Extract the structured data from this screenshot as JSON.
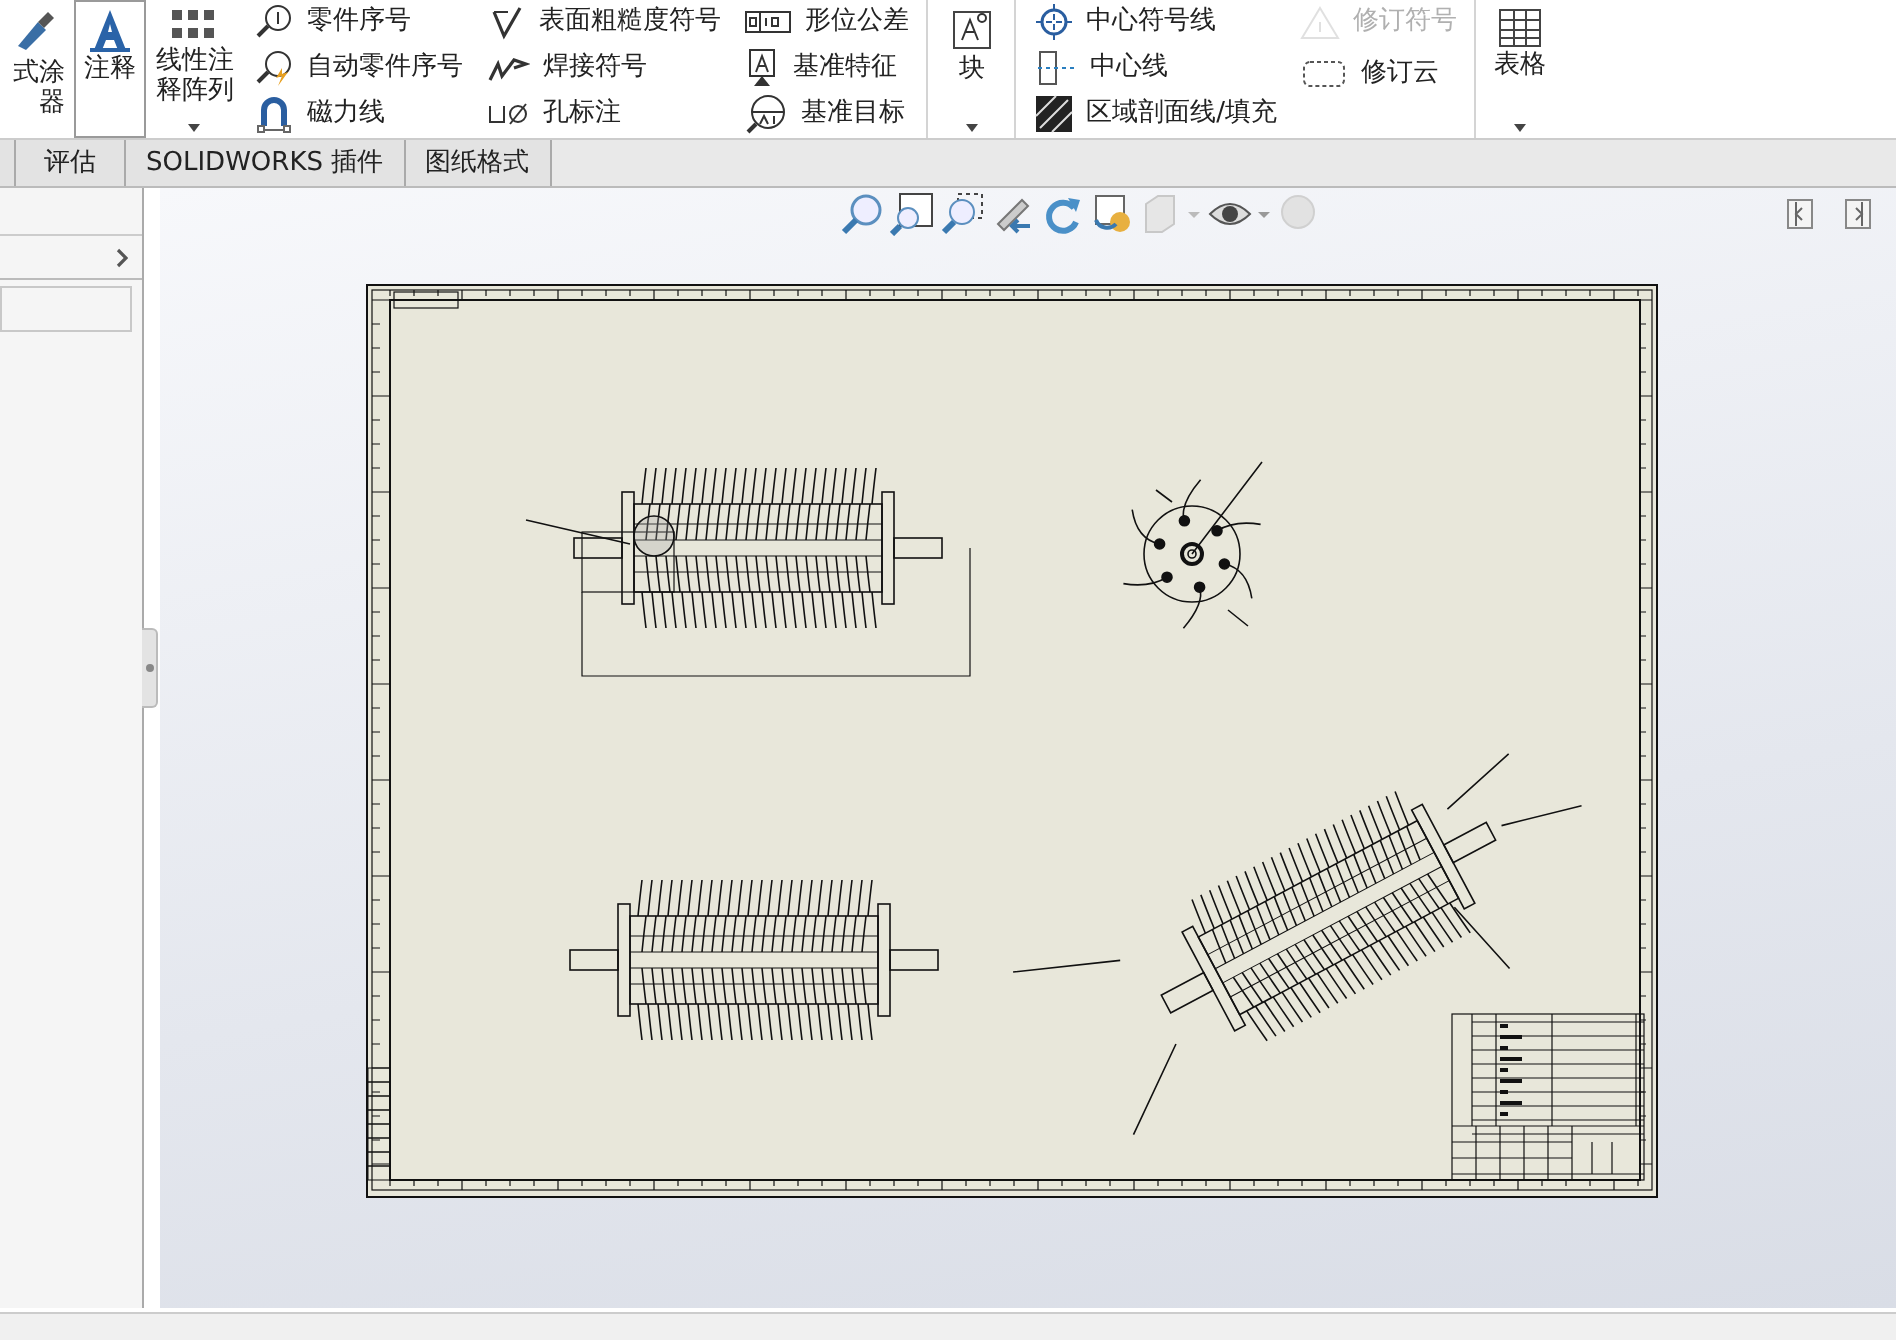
{
  "ribbon": {
    "groups": [
      {
        "kind": "large",
        "lines": [
          "式涂",
          "器"
        ],
        "selected": false,
        "dropdown": false
      },
      {
        "kind": "large",
        "label": "注释",
        "selected": true,
        "dropdown": false
      },
      {
        "kind": "large",
        "label": "线性注释阵列",
        "selected": false,
        "dropdown": true
      },
      {
        "kind": "column",
        "items": [
          {
            "label": "零件序号",
            "disabled": false
          },
          {
            "label": "自动零件序号",
            "disabled": false
          },
          {
            "label": "磁力线",
            "disabled": false
          }
        ]
      },
      {
        "kind": "column",
        "items": [
          {
            "label": "表面粗糙度符号",
            "disabled": false
          },
          {
            "label": "焊接符号",
            "disabled": false
          },
          {
            "label": "孔标注",
            "disabled": false
          }
        ]
      },
      {
        "kind": "column",
        "items": [
          {
            "label": "形位公差",
            "disabled": false
          },
          {
            "label": "基准特征",
            "disabled": false
          },
          {
            "label": "基准目标",
            "disabled": false
          }
        ]
      },
      {
        "kind": "large",
        "label": "块",
        "selected": false,
        "dropdown": true
      },
      {
        "kind": "column",
        "items": [
          {
            "label": "中心符号线",
            "disabled": false
          },
          {
            "label": "中心线",
            "disabled": false
          },
          {
            "label": "区域剖面线/填充",
            "disabled": false
          }
        ]
      },
      {
        "kind": "column",
        "items": [
          {
            "label": "修订符号",
            "disabled": true
          },
          {
            "label": "修订云",
            "disabled": false
          }
        ]
      },
      {
        "kind": "large",
        "label": "表格",
        "selected": false,
        "dropdown": true
      }
    ]
  },
  "tabs": [
    {
      "label": "评估",
      "selected": false
    },
    {
      "label": "SOLIDWORKS 插件",
      "selected": false
    },
    {
      "label": "图纸格式",
      "selected": false
    }
  ]
}
